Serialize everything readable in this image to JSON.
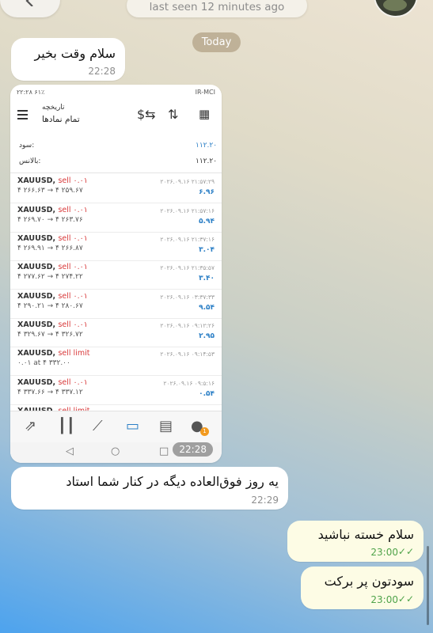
{
  "header": {
    "status": "last seen 12 minutes ago",
    "date_chip": "Today"
  },
  "messages": [
    {
      "text": "سلام وقت بخیر",
      "time": "22:28"
    },
    {
      "image_time": "22:28"
    },
    {
      "text": "یه روز فوق‌العاده دیگه در کنار شما استاد",
      "time": "22:29"
    },
    {
      "text": "سلام خسته نباشید",
      "time": "23:00"
    },
    {
      "text": "سودتون پر برکت",
      "time": "23:00"
    }
  ],
  "screenshot": {
    "status_left": "۲۲:۲۸ ۶۱٪",
    "status_right": "IR-MCI",
    "title": "تاریخچه",
    "subtitle": "تمام نمادها",
    "summary": [
      {
        "label": "سود:",
        "value": "۱۱۲.۲۰"
      },
      {
        "label": "بالانس:",
        "value": "۱۱۲.۲۰"
      }
    ],
    "trades": [
      {
        "symbol": "XAUUSD,",
        "type": "sell ۰.۰۱",
        "prices": "۴ ۲۶۶.۶۳ → ۴ ۲۵۹.۶۷",
        "date": "۲۰۲۶.۰۹.۱۶ ۲۱:۵۷:۲۹",
        "profit": "۶.۹۶"
      },
      {
        "symbol": "XAUUSD,",
        "type": "sell ۰.۰۱",
        "prices": "۴ ۲۶۹.۷۰ → ۴ ۲۶۳.۷۶",
        "date": "۲۰۲۶.۰۹.۱۶ ۲۱:۵۷:۱۶",
        "profit": "۵.۹۴"
      },
      {
        "symbol": "XAUUSD,",
        "type": "sell ۰.۰۱",
        "prices": "۴ ۲۶۹.۹۱ → ۴ ۲۶۶.۸۷",
        "date": "۲۰۲۶.۰۹.۱۶ ۲۱:۳۷:۱۶",
        "profit": "۳.۰۴"
      },
      {
        "symbol": "XAUUSD,",
        "type": "sell ۰.۰۱",
        "prices": "۴ ۲۷۷.۶۲ → ۴ ۲۷۴.۲۲",
        "date": "۲۰۲۶.۰۹.۱۶ ۲۱:۳۵:۵۷",
        "profit": "۳.۴۰"
      },
      {
        "symbol": "XAUUSD,",
        "type": "sell ۰.۰۱",
        "prices": "۴ ۲۹۰.۲۱ → ۴ ۲۸۰.۶۷",
        "date": "۲۰۲۶.۰۹.۱۶ ۰۳:۳۷:۳۳",
        "profit": "۹.۵۴"
      },
      {
        "symbol": "XAUUSD,",
        "type": "sell ۰.۰۱",
        "prices": "۴ ۳۲۹.۶۷ → ۴ ۳۲۶.۷۲",
        "date": "۲۰۲۶.۰۹.۱۶ ۰۹:۱۲:۲۶",
        "profit": "۲.۹۵"
      },
      {
        "symbol": "XAUUSD,",
        "type": "sell limit",
        "prices": "۰.۰۱ at ۴ ۳۳۲.۰۰",
        "date": "۲۰۲۶.۰۹.۱۶ ۰۹:۱۴:۵۳",
        "profit": ""
      },
      {
        "symbol": "XAUUSD,",
        "type": "sell ۰.۰۱",
        "prices": "۴ ۳۳۷.۶۶ → ۴ ۳۳۷.۱۲",
        "date": "۲۰۲۶.۰۹.۱۶ ۰۹:۵:۱۶",
        "profit": "۰.۵۴"
      },
      {
        "symbol": "XAUUSD,",
        "type": "sell limit",
        "prices": "",
        "date": "",
        "profit": ""
      }
    ],
    "nav_badge": "1"
  },
  "icons": [
    "chevron-left-icon",
    "calendar-icon",
    "sort-icon",
    "dollar-exchange-icon",
    "menu-icon",
    "trade-icon",
    "candles-icon",
    "chart-icon",
    "inbox-icon",
    "news-icon",
    "chat-icon",
    "double-check-icon"
  ],
  "colors": {
    "sell": "#d8393a",
    "profit": "#2b7fc6",
    "outgoing_bubble": "#fdfce5",
    "check": "#4fa34a"
  }
}
